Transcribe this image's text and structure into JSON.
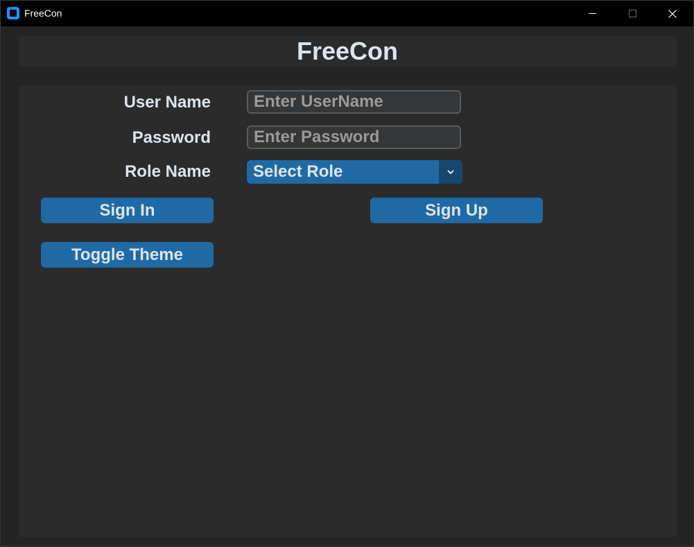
{
  "window": {
    "title": "FreeCon",
    "icon": "app-icon"
  },
  "header": {
    "title": "FreeCon"
  },
  "form": {
    "username": {
      "label": "User Name",
      "placeholder": "Enter UserName",
      "value": ""
    },
    "password": {
      "label": "Password",
      "placeholder": "Enter Password",
      "value": ""
    },
    "role": {
      "label": "Role Name",
      "selected": "Select Role"
    }
  },
  "buttons": {
    "sign_in": "Sign In",
    "sign_up": "Sign Up",
    "toggle_theme": "Toggle Theme"
  },
  "colors": {
    "background": "#242424",
    "panel": "#2b2b2b",
    "accent": "#1f6aa5",
    "accent_dark": "#144870",
    "text": "#dce4ee"
  }
}
